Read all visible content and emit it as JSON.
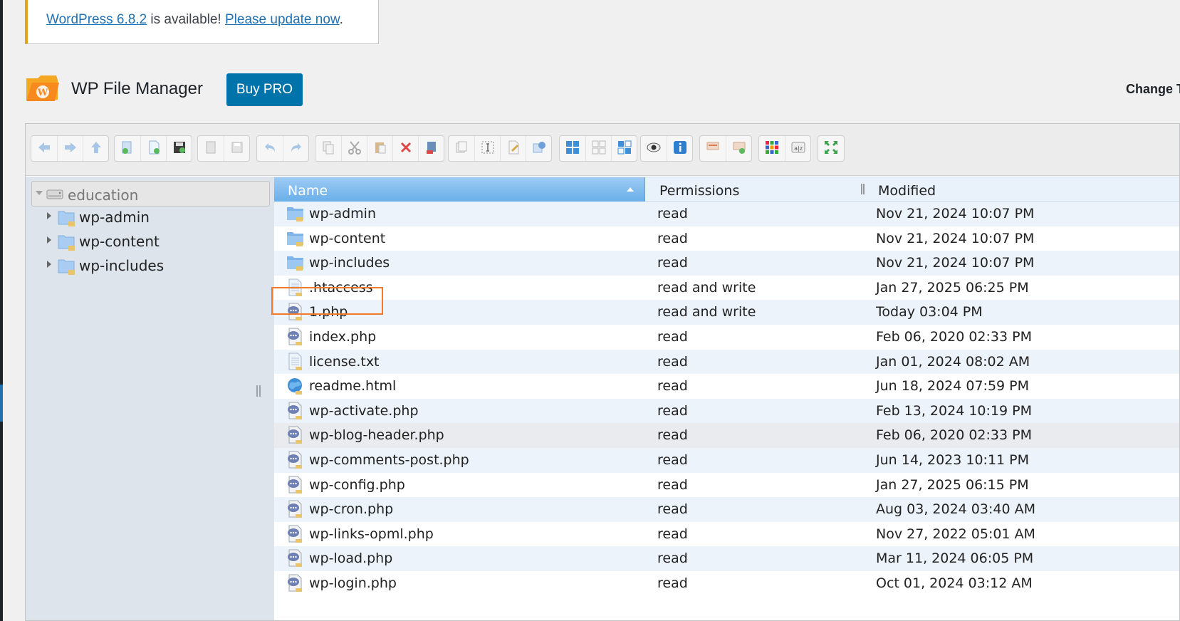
{
  "notice": {
    "version_link": "WordPress 6.8.2",
    "middle_text": " is available! ",
    "update_link": "Please update now",
    "end_text": "."
  },
  "header": {
    "title": "WP File Manager",
    "buy_pro": "Buy PRO",
    "change_theme": "Change T"
  },
  "colors": {
    "accent": "#0073aa",
    "notice_border": "#dba617",
    "header_selected": "#68aee9",
    "highlight": "#f07a2a"
  },
  "toolbar_icons": [
    [
      "back-icon",
      "forward-icon",
      "up-folder-icon"
    ],
    [
      "new-folder-icon",
      "new-file-icon",
      "save-icon"
    ],
    [
      "open-icon",
      "download-icon"
    ],
    [
      "undo-icon",
      "redo-icon"
    ],
    [
      "copy-icon",
      "cut-icon",
      "paste-icon",
      "delete-icon",
      "empty-icon"
    ],
    [
      "duplicate-icon",
      "rename-icon",
      "edit-icon",
      "resize-icon"
    ],
    [
      "select-all-icon",
      "select-none-icon",
      "invert-selection-icon"
    ],
    [
      "preview-icon",
      "info-icon"
    ],
    [
      "extract-icon",
      "archive-icon"
    ],
    [
      "icons-view-icon",
      "sort-icon"
    ],
    [
      "fullscreen-icon"
    ]
  ],
  "tree": {
    "root": "education",
    "items": [
      {
        "label": "wp-admin"
      },
      {
        "label": "wp-content"
      },
      {
        "label": "wp-includes"
      }
    ]
  },
  "columns": {
    "name": "Name",
    "permissions": "Permissions",
    "modified": "Modified"
  },
  "files": [
    {
      "name": "wp-admin",
      "perm": "read",
      "modified": "Nov 21, 2024 10:07 PM",
      "icon": "folder-icon"
    },
    {
      "name": "wp-content",
      "perm": "read",
      "modified": "Nov 21, 2024 10:07 PM",
      "icon": "folder-icon"
    },
    {
      "name": "wp-includes",
      "perm": "read",
      "modified": "Nov 21, 2024 10:07 PM",
      "icon": "folder-icon"
    },
    {
      "name": ".htaccess",
      "perm": "read and write",
      "modified": "Jan 27, 2025 06:25 PM",
      "icon": "text-file-icon"
    },
    {
      "name": "1.php",
      "perm": "read and write",
      "modified": "Today 03:04 PM",
      "icon": "php-file-icon"
    },
    {
      "name": "index.php",
      "perm": "read",
      "modified": "Feb 06, 2020 02:33 PM",
      "icon": "php-file-icon"
    },
    {
      "name": "license.txt",
      "perm": "read",
      "modified": "Jan 01, 2024 08:02 AM",
      "icon": "text-file-icon"
    },
    {
      "name": "readme.html",
      "perm": "read",
      "modified": "Jun 18, 2024 07:59 PM",
      "icon": "html-file-icon"
    },
    {
      "name": "wp-activate.php",
      "perm": "read",
      "modified": "Feb 13, 2024 10:19 PM",
      "icon": "php-file-icon"
    },
    {
      "name": "wp-blog-header.php",
      "perm": "read",
      "modified": "Feb 06, 2020 02:33 PM",
      "icon": "php-file-icon"
    },
    {
      "name": "wp-comments-post.php",
      "perm": "read",
      "modified": "Jun 14, 2023 10:11 PM",
      "icon": "php-file-icon"
    },
    {
      "name": "wp-config.php",
      "perm": "read",
      "modified": "Jan 27, 2025 06:15 PM",
      "icon": "php-file-icon"
    },
    {
      "name": "wp-cron.php",
      "perm": "read",
      "modified": "Aug 03, 2024 03:40 AM",
      "icon": "php-file-icon"
    },
    {
      "name": "wp-links-opml.php",
      "perm": "read",
      "modified": "Nov 27, 2022 05:01 AM",
      "icon": "php-file-icon"
    },
    {
      "name": "wp-load.php",
      "perm": "read",
      "modified": "Mar 11, 2024 06:05 PM",
      "icon": "php-file-icon"
    },
    {
      "name": "wp-login.php",
      "perm": "read",
      "modified": "Oct 01, 2024 03:12 AM",
      "icon": "php-file-icon"
    }
  ]
}
